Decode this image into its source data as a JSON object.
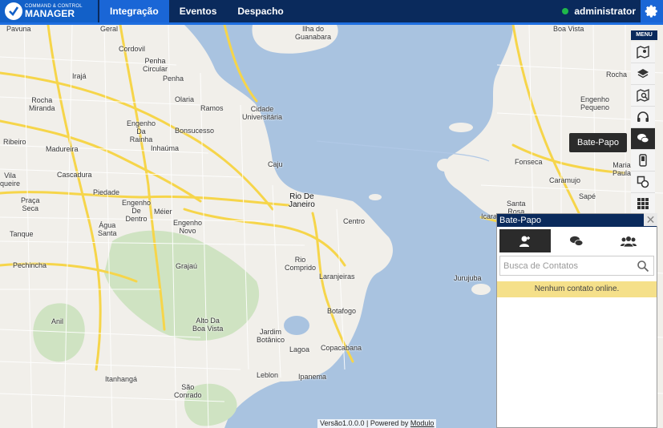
{
  "app": {
    "logo_small": "COMMAND & CONTROL",
    "logo_big": "MANAGER"
  },
  "nav": {
    "items": [
      {
        "label": "Integração",
        "active": true
      },
      {
        "label": "Eventos",
        "active": false
      },
      {
        "label": "Despacho",
        "active": false
      }
    ]
  },
  "user": {
    "name": "administrator",
    "status_color": "#1fb84a"
  },
  "menu": {
    "label": "MENU",
    "items": [
      {
        "icon": "map-icon"
      },
      {
        "icon": "layers-icon"
      },
      {
        "icon": "map-search-icon"
      },
      {
        "icon": "headset-icon"
      },
      {
        "icon": "chat-icon",
        "active": true
      },
      {
        "icon": "mobile-device-icon"
      },
      {
        "icon": "shapes-icon"
      },
      {
        "icon": "grid-icon"
      }
    ],
    "tooltip": "Bate-Papo"
  },
  "chat": {
    "title": "Bate-Papo",
    "close": "✕",
    "tabs": [
      {
        "icon": "contacts-icon",
        "active": true
      },
      {
        "icon": "conversations-icon",
        "active": false
      },
      {
        "icon": "groups-icon",
        "active": false
      }
    ],
    "search_placeholder": "Busca de Contatos",
    "empty_message": "Nenhum contato online."
  },
  "footer": {
    "version": "Versão1.0.0.0 | Powered by ",
    "link": "Modulo"
  },
  "map": {
    "places": [
      "Pavuna",
      "Geral",
      "Cordovil",
      "Penha\nCircular",
      "Penha",
      "Irajá",
      "Olaria",
      "Ramos",
      "Cidade\nUniversitária",
      "Ilha do\nGuanabara",
      "Boa Vista",
      "Rocha",
      "Engenho\nPequeno",
      "Rocha\nMiranda",
      "Engenho\nDa\nRainha",
      "Bonsucesso",
      "Inhaúma",
      "Madureira",
      "Ribeiro",
      "Cascadura",
      "Piedade",
      "Caju",
      "Fonseca",
      "Maria\nPaula",
      "Caramujo",
      "Vila\nqueire",
      "Praça\nSeca",
      "Engenho\nDe\nDentro",
      "Méier",
      "Rio De\nJaneiro",
      "Centro",
      "Santa\nRosa",
      "Sapé",
      "Icaraí",
      "Água\nSanta",
      "Engenho\nNovo",
      "Tanque",
      "Pechincha",
      "Grajaú",
      "Rio\nComprido",
      "Laranjeiras",
      "Jurujuba",
      "Anil",
      "Alto Da\nBoa Vista",
      "Botafogo",
      "Jardim\nBotânico",
      "Lagoa",
      "Copacabana",
      "Itanhangá",
      "Leblon",
      "Ipanema",
      "São\nConrado"
    ]
  }
}
